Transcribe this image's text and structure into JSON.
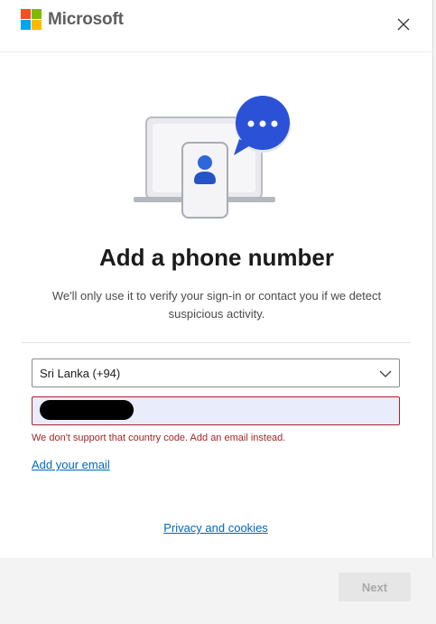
{
  "brand": {
    "name": "Microsoft"
  },
  "header": {
    "close_icon": "close-icon"
  },
  "main": {
    "title": "Add a phone number",
    "description": "We'll only use it to verify your sign-in or contact you if we detect suspicious activity.",
    "country_select": {
      "value": "Sri Lanka (+94)"
    },
    "phone_input": {
      "value": ""
    },
    "error": "We don't support that country code. Add an email instead.",
    "add_email_link": "Add your email",
    "privacy_link": "Privacy and cookies"
  },
  "footer": {
    "next_label": "Next"
  },
  "colors": {
    "accent": "#0067b8",
    "error": "#a4262c",
    "chat_bubble": "#2b52d6"
  }
}
